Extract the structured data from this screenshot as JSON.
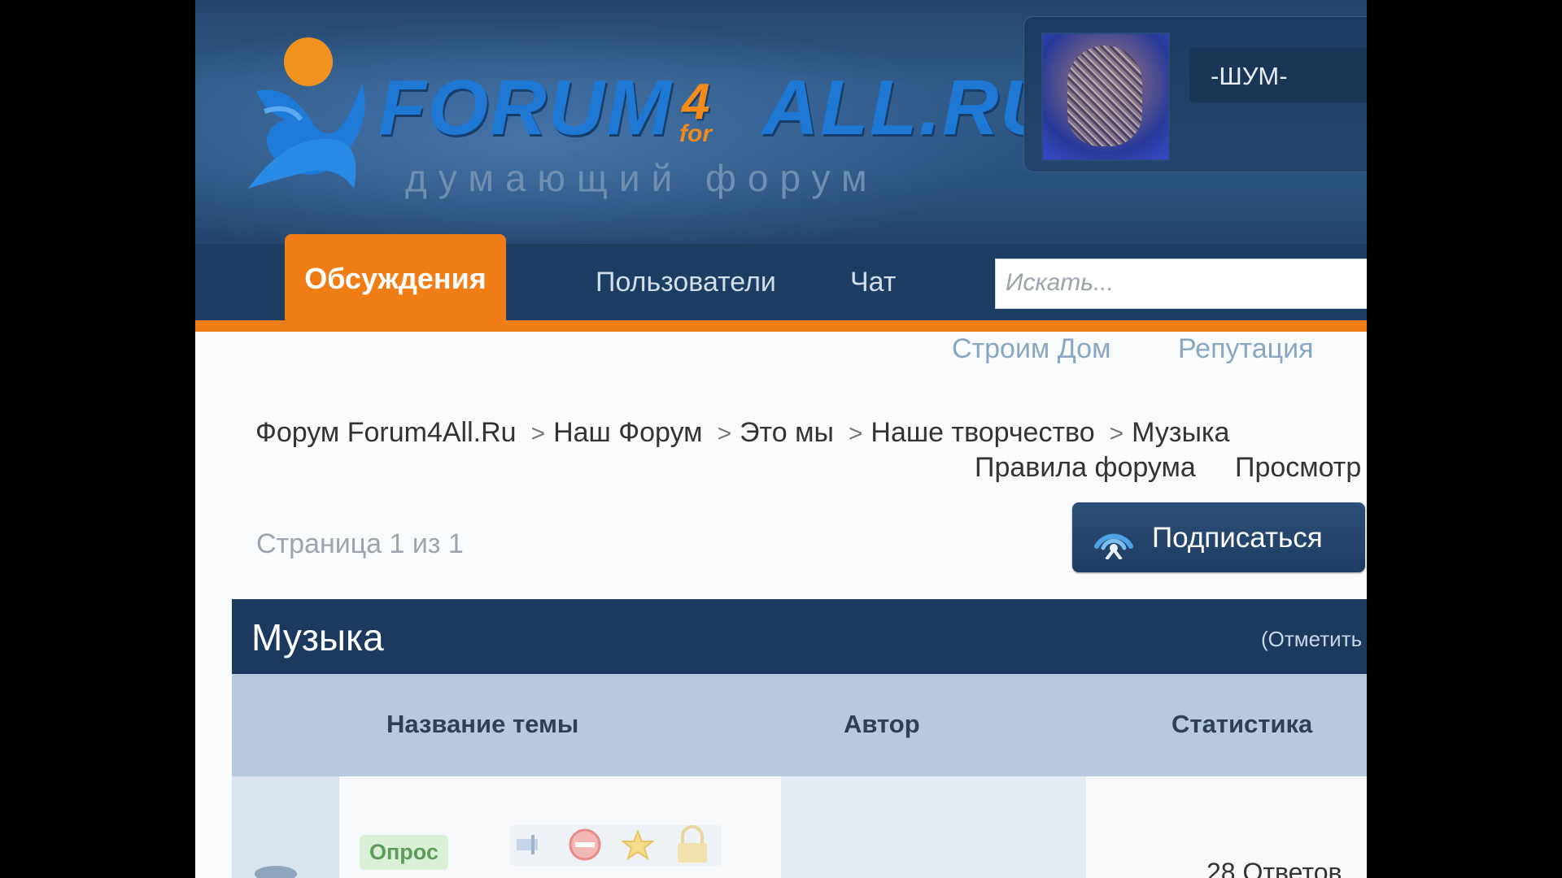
{
  "header": {
    "logo_title": "FORUM",
    "logo_four": "4",
    "logo_for": "for",
    "logo_title_rest": "ALL.RU",
    "logo_subtitle": "думающий форум",
    "username": "-ШУМ-"
  },
  "nav": {
    "active_tab": "Обсуждения",
    "users": "Пользователи",
    "chat": "Чат",
    "search_placeholder": "Искать..."
  },
  "sub_links": {
    "build_house": "Строим Дом",
    "reputation": "Репутация"
  },
  "breadcrumb": [
    "Форум Forum4All.Ru",
    "Наш Форум",
    "Это мы",
    "Наше творчество",
    "Музыка"
  ],
  "breadcrumb_separator": ">",
  "rules_links": {
    "rules": "Правила форума",
    "view": "Просмотр"
  },
  "pagination": {
    "text": "Страница 1 из 1"
  },
  "subscribe_button": "Подписаться",
  "forum": {
    "title": "Музыка",
    "mark_read": "(Отметить",
    "columns": [
      "Название темы",
      "Автор",
      "Статистика"
    ],
    "rows": [
      {
        "badge": "Опрос",
        "stats": "28 Ответов"
      }
    ]
  },
  "colors": {
    "accent_orange": "#f07d15",
    "nav_blue": "#1e3d62",
    "header_blue": "#2f5a88"
  },
  "icons": [
    "logo-figure-icon",
    "feed-icon",
    "topic-sticky-icon",
    "topic-blocked-icon",
    "topic-star-icon",
    "topic-lock-icon"
  ]
}
